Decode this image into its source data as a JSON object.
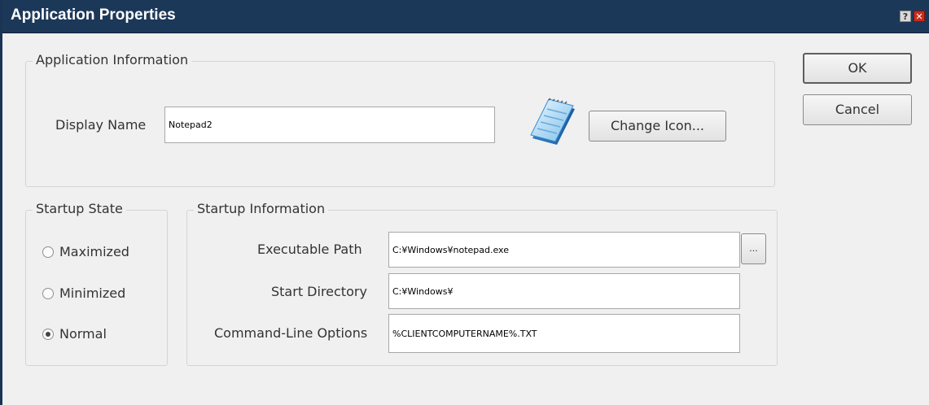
{
  "window": {
    "title": "Application Properties",
    "help_glyph": "?",
    "close_glyph": "✕"
  },
  "buttons": {
    "ok": "OK",
    "cancel": "Cancel",
    "change_icon": "Change Icon...",
    "browse": "..."
  },
  "app_info": {
    "legend": "Application Information",
    "display_name_label": "Display Name",
    "display_name_value": "Notepad2",
    "icon": "notepad-icon"
  },
  "startup_state": {
    "legend": "Startup State",
    "options": [
      {
        "label": "Maximized",
        "checked": false
      },
      {
        "label": "Minimized",
        "checked": false
      },
      {
        "label": "Normal",
        "checked": true
      }
    ]
  },
  "startup_info": {
    "legend": "Startup Information",
    "exe_path_label": "Executable Path",
    "exe_path_value": "C:¥Windows¥notepad.exe",
    "start_dir_label": "Start Directory",
    "start_dir_value": "C:¥Windows¥",
    "cmdline_label": "Command-Line Options",
    "cmdline_value": "%CLIENTCOMPUTERNAME%.TXT"
  }
}
